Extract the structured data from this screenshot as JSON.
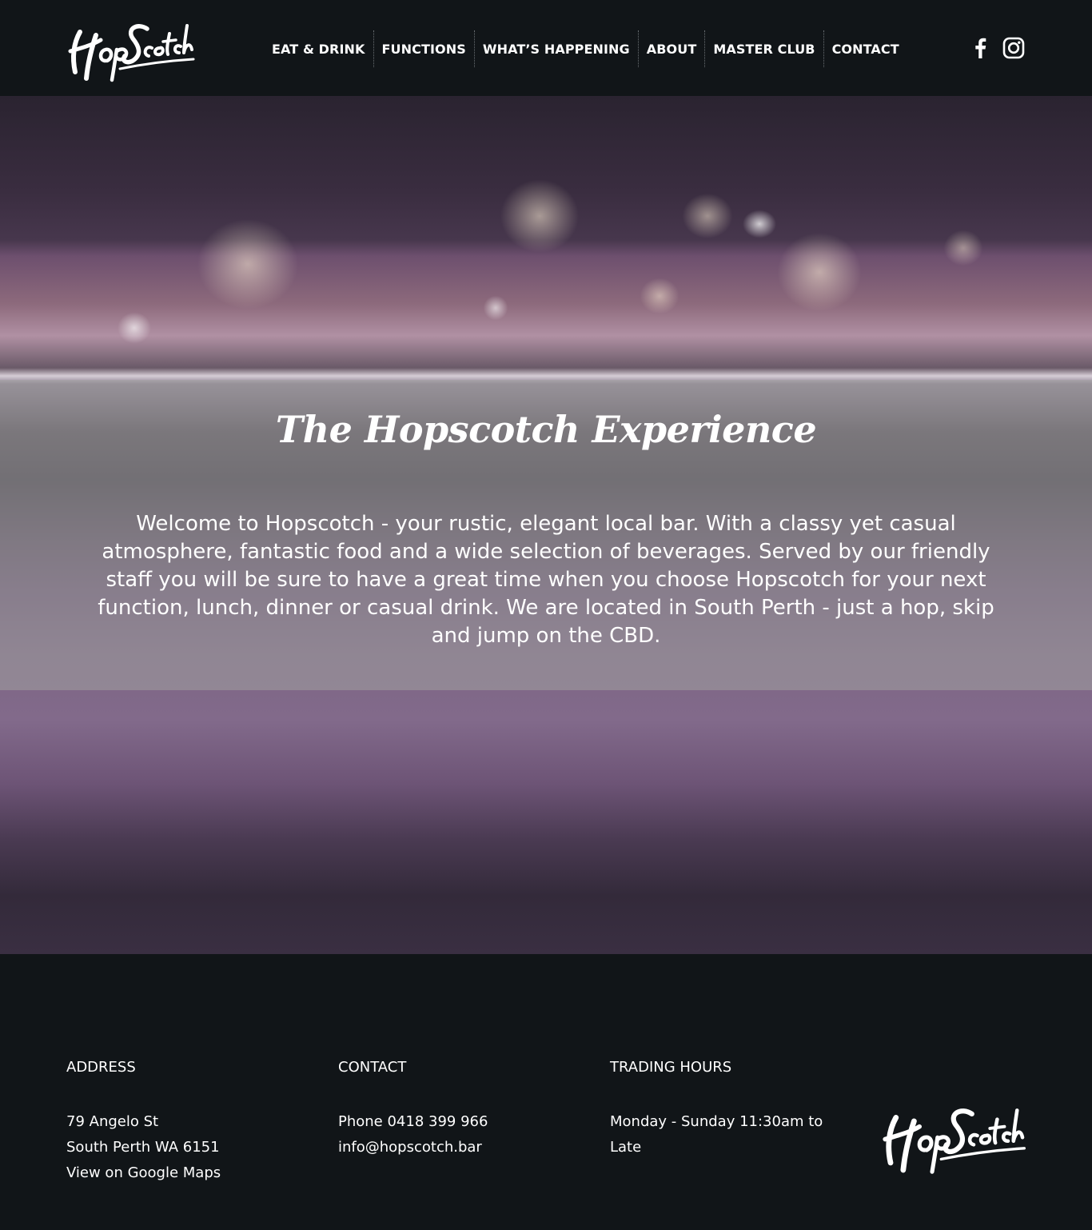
{
  "brand": {
    "logo_text": "HopScotch"
  },
  "nav": {
    "items": [
      {
        "label": "EAT & DRINK"
      },
      {
        "label": "FUNCTIONS"
      },
      {
        "label": "WHAT’S HAPPENING"
      },
      {
        "label": "ABOUT"
      },
      {
        "label": "MASTER CLUB"
      },
      {
        "label": "CONTACT"
      }
    ]
  },
  "social": {
    "icons": [
      "facebook-icon",
      "instagram-icon"
    ]
  },
  "hero": {
    "title": "The Hopscotch Experience",
    "text": "Welcome to Hopscotch - your rustic, elegant local bar. With a classy yet casual atmosphere, fantastic food and a wide selection of beverages. Served by our friendly staff you will be sure to have a great time when you choose Hopscotch for your next function, lunch, dinner or casual drink. We are located in South Perth - just a hop, skip and jump on the CBD."
  },
  "footer": {
    "address": {
      "heading": "ADDRESS",
      "line1": "79 Angelo St",
      "line2": "South Perth WA 6151",
      "map_link": "View on Google Maps"
    },
    "contact": {
      "heading": "CONTACT",
      "phone": "Phone 0418 399 966",
      "email": "info@hopscotch.bar"
    },
    "hours": {
      "heading": "TRADING HOURS",
      "line1": "Monday - Sunday 11:30am to",
      "line2": "Late"
    }
  },
  "colors": {
    "background": "#111518",
    "text": "#ffffff",
    "band": "#a0a0a0"
  }
}
